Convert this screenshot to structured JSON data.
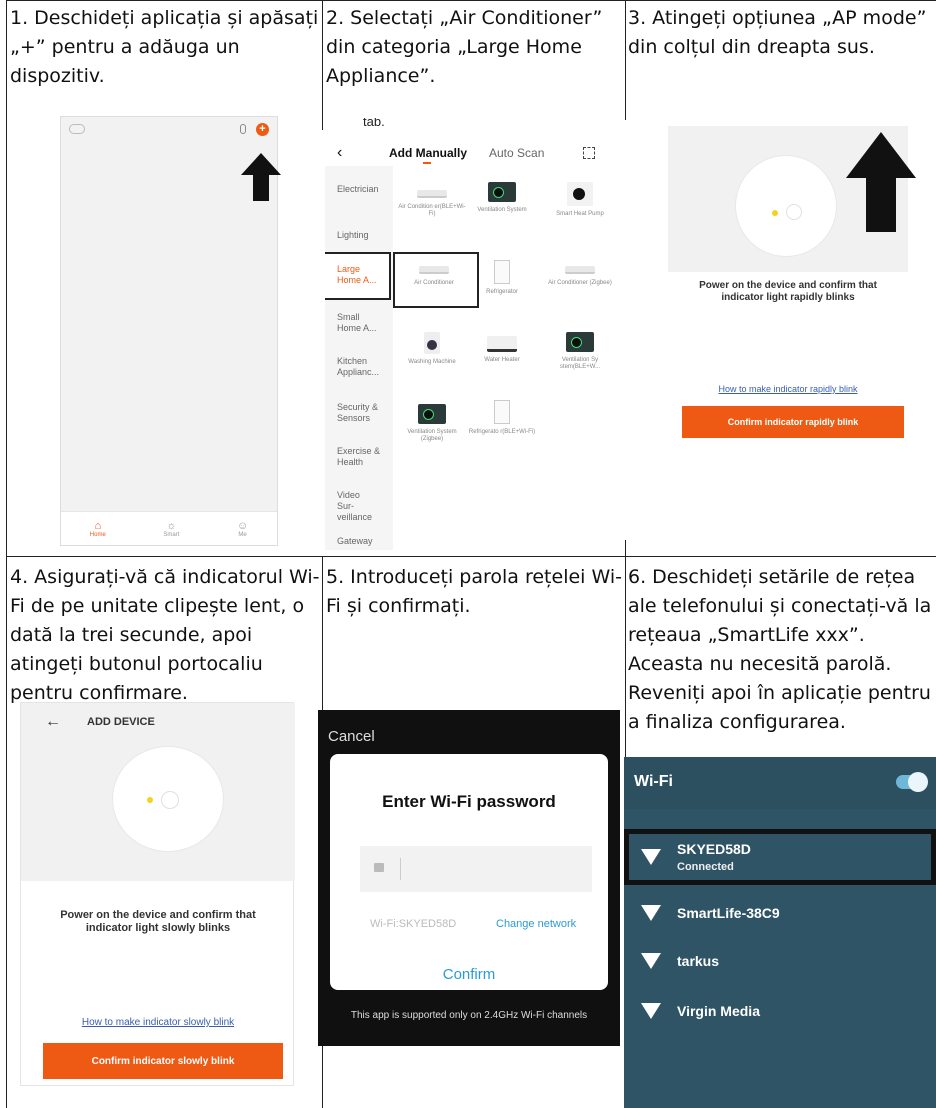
{
  "steps": [
    {
      "text": "1. Deschideți aplicația și apăsați „+” pentru a adăuga un dispozitiv."
    },
    {
      "text": "2. Selectați „Air Conditioner” din categoria „Large Home Appliance”."
    },
    {
      "text": "3. Atingeți opțiunea „AP mode” din colțul din dreapta sus."
    },
    {
      "text": "4. Asigurați-vă că indicatorul Wi-Fi de pe unitate clipește lent, o dată la trei secunde, apoi atingeți butonul portocaliu pentru confirmare."
    },
    {
      "text": "5. Introduceți parola rețelei Wi-Fi și confirmați."
    },
    {
      "text": "6. Deschideți setările de rețea ale telefonului și conectați-vă la rețeaua „SmartLife xxx”. Aceasta nu necesită parolă. Reveniți apoi în aplicație pentru a finaliza configurarea."
    }
  ],
  "screen1": {
    "tabs": [
      "Home",
      "Smart",
      "Me"
    ]
  },
  "screen2": {
    "cut_text": "tab.",
    "tab_manual": "Add Manually",
    "tab_auto": "Auto Scan",
    "sidebar": [
      "Electrician",
      "Lighting",
      "Large Home A...",
      "Small Home A...",
      "Kitchen Applianc...",
      "Security & Sensors",
      "Exercise & Health",
      "Video Sur- veillance",
      "Gateway"
    ],
    "devices": [
      "Air Condition er(BLE+Wi-Fi)",
      "Ventilation System",
      "Smart Heat Pump",
      "Air Conditioner",
      "Refrigerator",
      "Air Conditioner (Zigbee)",
      "Washing Machine",
      "Water Heater",
      "Ventilation Sy stem(BLE+W...",
      "Ventilation System (Zigbee)",
      "Refrigerato r(BLE+Wi-Fi)"
    ]
  },
  "screen3": {
    "instruction": "Power on the device and confirm that indicator light rapidly blinks",
    "link": "How to make indicator rapidly blink",
    "button": "Confirm indicator rapidly blink"
  },
  "screen4": {
    "header": "ADD DEVICE",
    "instruction": "Power on the device and confirm that indicator light slowly blinks",
    "link": "How to make indicator slowly blink",
    "button": "Confirm indicator slowly blink"
  },
  "screen5": {
    "cancel": "Cancel",
    "title": "Enter Wi-Fi password",
    "wifi_label": "Wi-Fi:SKYED58D",
    "change_network": "Change network",
    "confirm": "Confirm",
    "footer": "This app is supported only on 2.4GHz Wi-Fi channels"
  },
  "screen6": {
    "title": "Wi-Fi",
    "networks": [
      {
        "name": "SKYED58D",
        "status": "Connected"
      },
      {
        "name": "SmartLife-38C9"
      },
      {
        "name": "tarkus"
      },
      {
        "name": "Virgin Media"
      }
    ]
  }
}
